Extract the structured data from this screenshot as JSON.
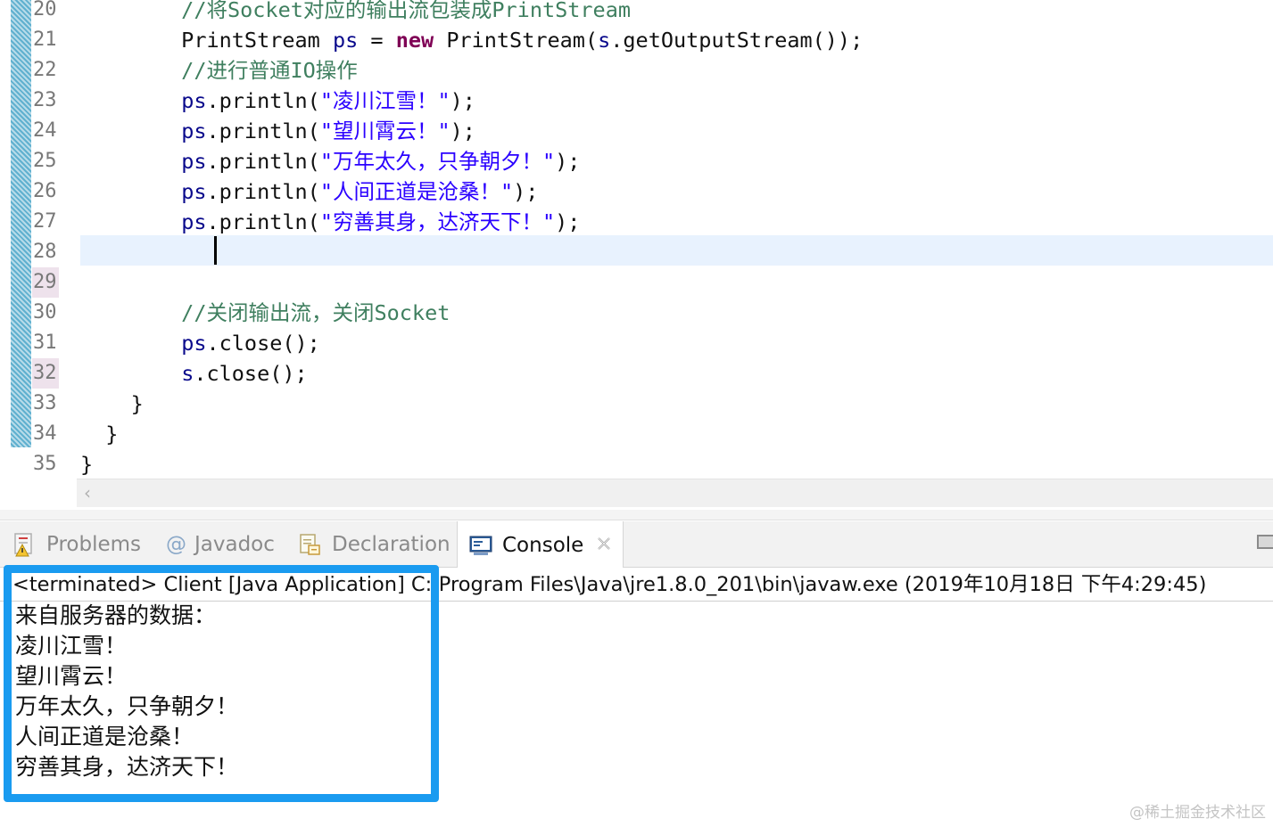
{
  "editor": {
    "line_numbers": [
      "20",
      "21",
      "22",
      "23",
      "24",
      "25",
      "26",
      "27",
      "28",
      "29",
      "30",
      "31",
      "32",
      "33",
      "34",
      "35"
    ],
    "lines": [
      [
        {
          "t": "        //将Socket对应的输出流包装成PrintStream",
          "c": "cmt"
        }
      ],
      [
        {
          "t": "        PrintStream ",
          "c": ""
        },
        {
          "t": "ps",
          "c": "var"
        },
        {
          "t": " = ",
          "c": ""
        },
        {
          "t": "new",
          "c": "kw"
        },
        {
          "t": " PrintStream(",
          "c": ""
        },
        {
          "t": "s",
          "c": "var"
        },
        {
          "t": ".getOutputStream());",
          "c": ""
        }
      ],
      [
        {
          "t": "        //进行普通IO操作",
          "c": "cmt"
        }
      ],
      [
        {
          "t": "        ",
          "c": ""
        },
        {
          "t": "ps",
          "c": "var"
        },
        {
          "t": ".println(",
          "c": ""
        },
        {
          "t": "\"凌川江雪！\"",
          "c": "str"
        },
        {
          "t": ");",
          "c": ""
        }
      ],
      [
        {
          "t": "        ",
          "c": ""
        },
        {
          "t": "ps",
          "c": "var"
        },
        {
          "t": ".println(",
          "c": ""
        },
        {
          "t": "\"望川霄云！\"",
          "c": "str"
        },
        {
          "t": ");",
          "c": ""
        }
      ],
      [
        {
          "t": "        ",
          "c": ""
        },
        {
          "t": "ps",
          "c": "var"
        },
        {
          "t": ".println(",
          "c": ""
        },
        {
          "t": "\"万年太久，只争朝夕！\"",
          "c": "str"
        },
        {
          "t": ");",
          "c": ""
        }
      ],
      [
        {
          "t": "        ",
          "c": ""
        },
        {
          "t": "ps",
          "c": "var"
        },
        {
          "t": ".println(",
          "c": ""
        },
        {
          "t": "\"人间正道是沧桑！\"",
          "c": "str"
        },
        {
          "t": ");",
          "c": ""
        }
      ],
      [
        {
          "t": "        ",
          "c": ""
        },
        {
          "t": "ps",
          "c": "var"
        },
        {
          "t": ".println(",
          "c": ""
        },
        {
          "t": "\"穷善其身，达济天下！\"",
          "c": "str"
        },
        {
          "t": ");",
          "c": ""
        }
      ],
      [
        {
          "t": "",
          "c": ""
        }
      ],
      [
        {
          "t": "",
          "c": ""
        }
      ],
      [
        {
          "t": "        //关闭输出流，关闭Socket",
          "c": "cmt"
        }
      ],
      [
        {
          "t": "        ",
          "c": ""
        },
        {
          "t": "ps",
          "c": "var"
        },
        {
          "t": ".close();",
          "c": ""
        }
      ],
      [
        {
          "t": "        ",
          "c": ""
        },
        {
          "t": "s",
          "c": "var"
        },
        {
          "t": ".close();",
          "c": ""
        }
      ],
      [
        {
          "t": "    }",
          "c": ""
        }
      ],
      [
        {
          "t": "  }",
          "c": ""
        }
      ],
      [
        {
          "t": "}",
          "c": ""
        }
      ]
    ]
  },
  "tabs": {
    "problems": "Problems",
    "javadoc": "Javadoc",
    "declaration": "Declaration",
    "console": "Console"
  },
  "console": {
    "header": "<terminated> Client [Java Application] C:\\Program Files\\Java\\jre1.8.0_201\\bin\\javaw.exe (2019年10月18日 下午4:29:45)",
    "output": [
      "来自服务器的数据：",
      "凌川江雪！",
      "望川霄云！",
      "万年太久，只争朝夕！",
      "人间正道是沧桑！",
      "穷善其身，达济天下！"
    ]
  },
  "watermark": "@稀土掘金技术社区",
  "colors": {
    "highlight_box": "#1a9bf0",
    "comment": "#3f7f5f",
    "keyword": "#7f0055",
    "string": "#2a00ff"
  }
}
